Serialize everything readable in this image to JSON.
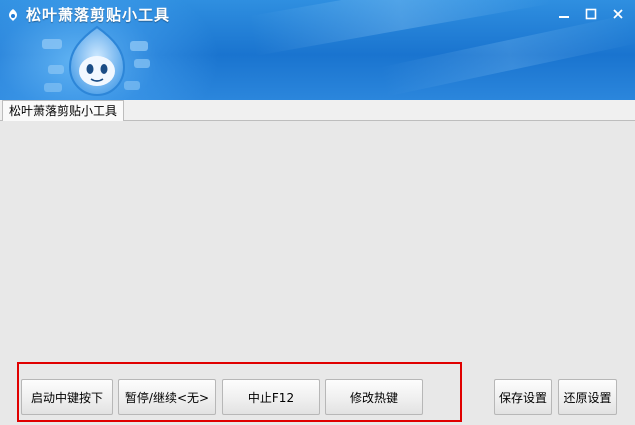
{
  "window": {
    "title": "松叶萧落剪贴小工具",
    "minimize_icon": "minimize-icon",
    "maximize_icon": "maximize-icon",
    "close_icon": "close-icon",
    "header_color": "#1f7ad4"
  },
  "tabs": [
    {
      "label": "松叶萧落剪贴小工具",
      "active": true
    }
  ],
  "actions": {
    "start_label": "启动中键按下",
    "pause_label": "暂停/继续<无>",
    "stop_label": "中止F12",
    "edit_hotkey_label": "修改热键",
    "save_label": "保存设置",
    "restore_label": "还原设置"
  },
  "highlight_color": "#e00000"
}
